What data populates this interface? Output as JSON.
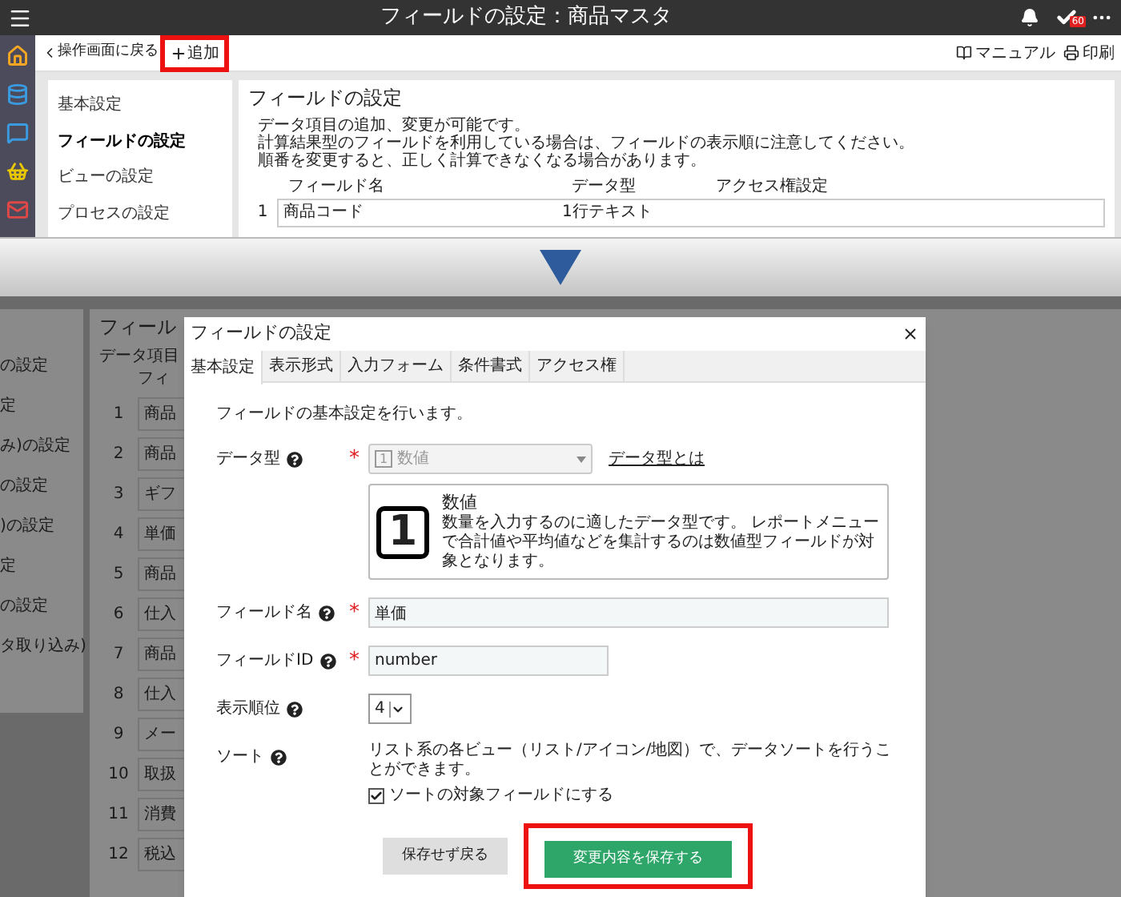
{
  "app_header": {
    "title": "フィールドの設定：商品マスタ",
    "badge": "60"
  },
  "toolbar": {
    "back": "操作画面に戻る",
    "add": "追加",
    "manual": "マニュアル",
    "print": "印刷"
  },
  "nav": [
    {
      "label": "基本設定",
      "selected": false
    },
    {
      "label": "フィールドの設定",
      "selected": true
    },
    {
      "label": "ビューの設定",
      "selected": false
    },
    {
      "label": "プロセスの設定",
      "selected": false
    }
  ],
  "panel": {
    "title": "フィールドの設定",
    "lines": [
      "データ項目の追加、変更が可能です。",
      "計算結果型のフィールドを利用している場合は、フィールドの表示順に注意してください。",
      "順番を変更すると、正しく計算できなくなる場合があります。"
    ],
    "columns": [
      "フィールド名",
      "データ型",
      "アクセス権設定"
    ],
    "row": {
      "number": "1",
      "name": "商品コード",
      "type": "1行テキスト"
    }
  },
  "background": {
    "nav": [
      "の設定",
      "定",
      "み)の設定",
      "の設定",
      ")の設定",
      "定",
      "の設定",
      "タ取り込み)"
    ],
    "title": "フィール",
    "text": "データ項目",
    "column": "フィ",
    "rows": [
      {
        "number": "1",
        "name": "商品"
      },
      {
        "number": "2",
        "name": "商品"
      },
      {
        "number": "3",
        "name": "ギフ"
      },
      {
        "number": "4",
        "name": "単価"
      },
      {
        "number": "5",
        "name": "商品"
      },
      {
        "number": "6",
        "name": "仕入"
      },
      {
        "number": "7",
        "name": "商品"
      },
      {
        "number": "8",
        "name": "仕入"
      },
      {
        "number": "9",
        "name": "メー"
      },
      {
        "number": "10",
        "name": "取扱"
      },
      {
        "number": "11",
        "name": "消費"
      },
      {
        "number": "12",
        "name": "税込"
      }
    ]
  },
  "dialog": {
    "title": "フィールドの設定",
    "tabs": [
      {
        "label": "基本設定",
        "selected": true
      },
      {
        "label": "表示形式",
        "selected": false
      },
      {
        "label": "入力フォーム",
        "selected": false
      },
      {
        "label": "条件書式",
        "selected": false
      },
      {
        "label": "アクセス権",
        "selected": false
      }
    ],
    "intro": "フィールドの基本設定を行います。",
    "fields": [
      {
        "kind": "select",
        "label": "データ型",
        "required_mark": "*",
        "glyph": "1",
        "value": "数値",
        "disabled": true,
        "link": "データ型とは",
        "card": {
          "glyph": "1",
          "title": "数値",
          "description": "数量を入力するのに適したデータ型です。 レポートメニューで合計値や平均値などを集計するのは数値型フィールドが対象となります。"
        }
      },
      {
        "kind": "text",
        "label": "フィールド名",
        "required_mark": "*",
        "value": "単価"
      },
      {
        "kind": "short-text",
        "label": "フィールドID",
        "required_mark": "*",
        "value": "number"
      },
      {
        "kind": "order",
        "label": "表示順位",
        "value": "4"
      },
      {
        "kind": "sort",
        "label": "ソート",
        "text": "リスト系の各ビュー（リスト/アイコン/地図）で、データソートを行うことができます。",
        "checkbox": "ソートの対象フィールドにする",
        "checked": true
      }
    ],
    "buttons": {
      "cancel": "保存せず戻る",
      "save": "変更内容を保存する"
    }
  }
}
